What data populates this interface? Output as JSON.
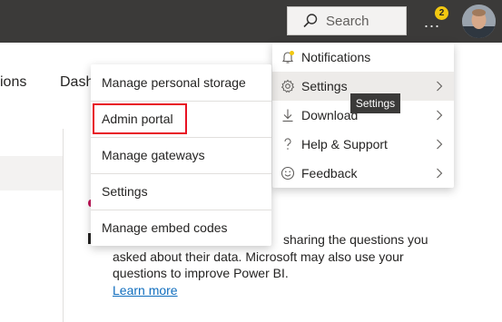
{
  "header": {
    "search_label": "Search",
    "more_label": "...",
    "notifications_count": "2",
    "bar_color": "#3b3a39",
    "badge_color": "#f2c811"
  },
  "background": {
    "nav_partial_1": "ions",
    "nav_partial_2": "Dash",
    "body_lines": [
      "sharing the questions you",
      "asked about their data. Microsoft may also use your",
      "questions to improve Power BI."
    ],
    "learn_more": "Learn more"
  },
  "account_menu": {
    "items": [
      {
        "label": "Notifications",
        "icon": "bell-icon",
        "has_submenu": false
      },
      {
        "label": "Settings",
        "icon": "gear-icon",
        "has_submenu": true
      },
      {
        "label": "Download",
        "icon": "download-icon",
        "has_submenu": true
      },
      {
        "label": "Help & Support",
        "icon": "question-icon",
        "has_submenu": true
      },
      {
        "label": "Feedback",
        "icon": "smiley-icon",
        "has_submenu": true
      }
    ],
    "tooltip": "Settings"
  },
  "settings_submenu": {
    "items": [
      {
        "label": "Manage personal storage"
      },
      {
        "label": "Admin portal"
      },
      {
        "label": "Manage gateways"
      },
      {
        "label": "Settings"
      },
      {
        "label": "Manage embed codes"
      }
    ],
    "highlight_color": "#e81123"
  }
}
